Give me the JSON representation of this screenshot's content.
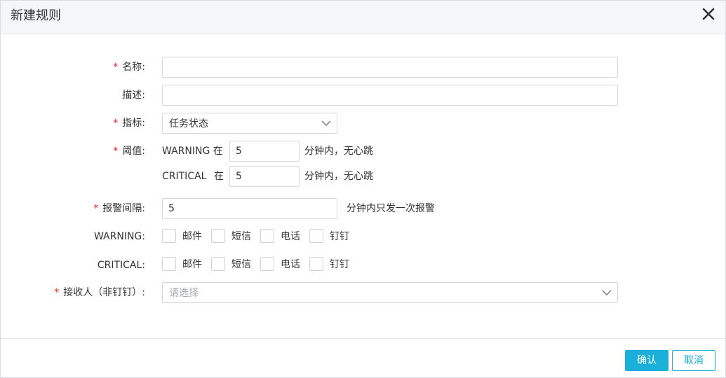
{
  "dialog": {
    "title": "新建规则",
    "close_icon": "close-icon"
  },
  "form": {
    "required_mark": "*",
    "name": {
      "label": "名称:",
      "value": "",
      "placeholder": ""
    },
    "description": {
      "label": "描述:",
      "value": "",
      "placeholder": ""
    },
    "metric": {
      "label": "指标:",
      "selected": "任务状态"
    },
    "threshold": {
      "label": "阈值:",
      "warning_level": "WARNING 在",
      "warning_value": "5",
      "warning_suffix": "分钟内，无心跳",
      "critical_level": "CRITICAL",
      "critical_in": "在",
      "critical_value": "5",
      "critical_suffix": "分钟内，无心跳"
    },
    "alert_interval": {
      "label": "报警间隔:",
      "value": "5",
      "suffix": "分钟内只发一次报警"
    },
    "warning_channels": {
      "label": "WARNING:",
      "options": [
        {
          "label": "邮件",
          "checked": false
        },
        {
          "label": "短信",
          "checked": false
        },
        {
          "label": "电话",
          "checked": false
        },
        {
          "label": "钉钉",
          "checked": false
        }
      ]
    },
    "critical_channels": {
      "label": "CRITICAL:",
      "options": [
        {
          "label": "邮件",
          "checked": false
        },
        {
          "label": "短信",
          "checked": false
        },
        {
          "label": "电话",
          "checked": false
        },
        {
          "label": "钉钉",
          "checked": false
        }
      ]
    },
    "receivers": {
      "label": "接收人（非钉钉）:",
      "placeholder": "请选择"
    }
  },
  "footer": {
    "confirm_label": "确认",
    "cancel_label": "取消"
  },
  "colors": {
    "accent": "#1ab0d9",
    "required": "#f5222d",
    "header_bg": "#f5f6f8",
    "border": "#d4d7dd"
  }
}
